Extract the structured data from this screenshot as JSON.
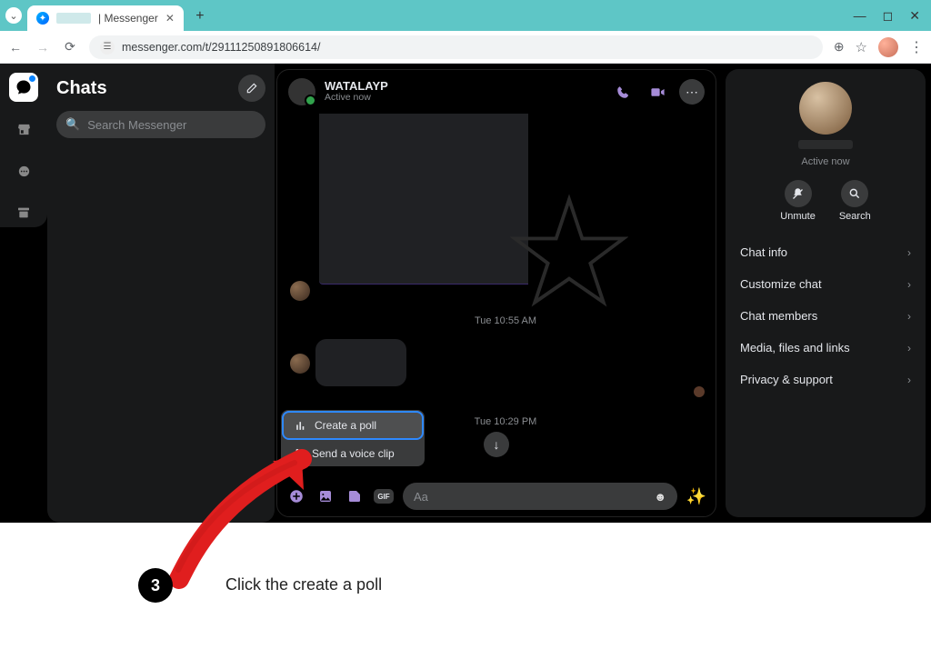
{
  "browser": {
    "tab_title": "| Messenger",
    "url": "messenger.com/t/29111250891806614/"
  },
  "rail": {
    "chats_icon": "chat",
    "marketplace_icon": "store",
    "requests_icon": "bubble",
    "archive_icon": "archive"
  },
  "sidebar": {
    "title": "Chats",
    "search_placeholder": "Search Messenger"
  },
  "conversation": {
    "title": "WATALAYP",
    "status": "Active now",
    "timestamp1": "Tue 10:55 AM",
    "timestamp2": "Tue 10:29 PM",
    "composer_placeholder": "Aa"
  },
  "popup": {
    "items": [
      {
        "icon": "poll",
        "label": "Create a poll"
      },
      {
        "icon": "mic",
        "label": "Send a voice clip"
      }
    ]
  },
  "info": {
    "status": "Active now",
    "actions": {
      "unmute": "Unmute",
      "search": "Search"
    },
    "sections": [
      "Chat info",
      "Customize chat",
      "Chat members",
      "Media, files and links",
      "Privacy & support"
    ]
  },
  "annotation": {
    "step": "3",
    "caption": "Click the create a poll"
  }
}
